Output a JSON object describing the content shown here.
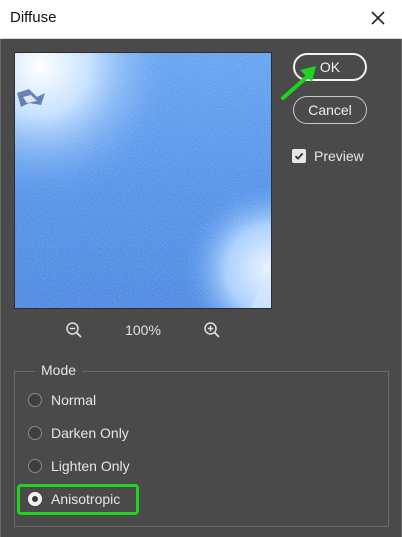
{
  "window": {
    "title": "Diffuse"
  },
  "buttons": {
    "ok": "OK",
    "cancel": "Cancel"
  },
  "preview_checkbox": {
    "label": "Preview",
    "checked": true
  },
  "zoom": {
    "level": "100%"
  },
  "mode": {
    "legend": "Mode",
    "options": [
      "Normal",
      "Darken Only",
      "Lighten Only",
      "Anisotropic"
    ],
    "selected": "Anisotropic"
  },
  "colors": {
    "dialog_bg": "#4a4a4a",
    "highlight": "#1fd41f",
    "preview_blue": "#3a86e8"
  },
  "icons": [
    "close-icon",
    "zoom-out-icon",
    "zoom-in-icon",
    "checkmark-icon",
    "arrow-annotation-icon"
  ]
}
